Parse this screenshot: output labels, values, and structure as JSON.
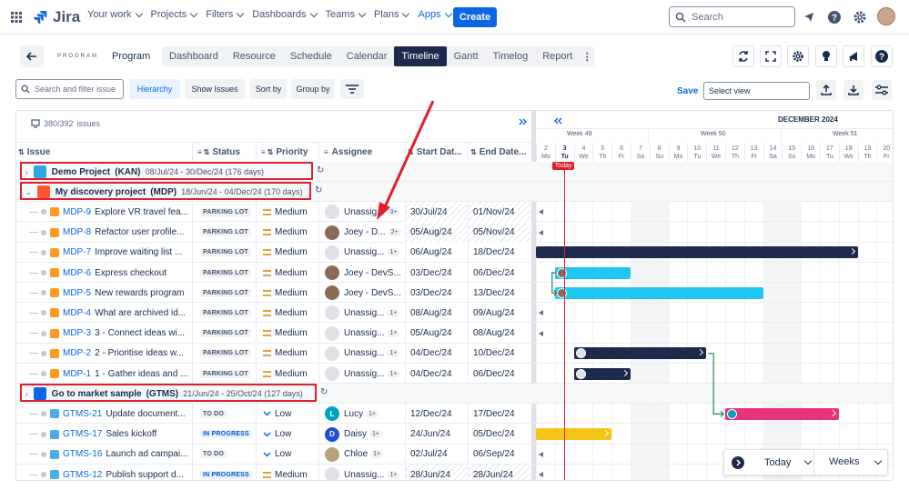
{
  "app": {
    "name": "Jira",
    "brand_color": "#0c66e4"
  },
  "topnav": {
    "items": [
      {
        "label": "Your work",
        "active": false
      },
      {
        "label": "Projects",
        "active": false
      },
      {
        "label": "Filters",
        "active": false
      },
      {
        "label": "Dashboards",
        "active": false
      },
      {
        "label": "Teams",
        "active": false
      },
      {
        "label": "Plans",
        "active": false
      },
      {
        "label": "Apps",
        "active": true
      }
    ],
    "create_label": "Create",
    "search_placeholder": "Search"
  },
  "program": {
    "badge": "PROGRAM",
    "name": "Program",
    "tabs": [
      "Dashboard",
      "Resource",
      "Schedule",
      "Calendar",
      "Timeline",
      "Gantt",
      "Timelog",
      "Report"
    ],
    "active_tab": "Timeline"
  },
  "filterbar": {
    "search_placeholder": "Search and filter issue",
    "hierarchy_label": "Hierarchy",
    "show_issues_label": "Show Issues",
    "sort_label": "Sort by",
    "group_label": "Group by",
    "save_label": "Save",
    "select_view_placeholder": "Select view"
  },
  "grid": {
    "issue_count": "380/392",
    "issue_count_suffix": "issues",
    "columns": {
      "issue": "Issue",
      "status": "Status",
      "priority": "Priority",
      "assignee": "Assignee",
      "start": "Start Dat...",
      "end": "End Date..."
    }
  },
  "timeline": {
    "month": "DECEMBER 2024",
    "weeks": [
      "Week 49",
      "Week 50",
      "Week 51"
    ],
    "days": [
      {
        "n": "2",
        "d": "Mo"
      },
      {
        "n": "3",
        "d": "Tu"
      },
      {
        "n": "4",
        "d": "We"
      },
      {
        "n": "5",
        "d": "Th"
      },
      {
        "n": "6",
        "d": "Fr"
      },
      {
        "n": "7",
        "d": "Sa"
      },
      {
        "n": "8",
        "d": "Su"
      },
      {
        "n": "9",
        "d": "Mo"
      },
      {
        "n": "10",
        "d": "Tu"
      },
      {
        "n": "11",
        "d": "We"
      },
      {
        "n": "12",
        "d": "Th"
      },
      {
        "n": "13",
        "d": "Fr"
      },
      {
        "n": "14",
        "d": "Sa"
      },
      {
        "n": "15",
        "d": "Su"
      },
      {
        "n": "16",
        "d": "Mo"
      },
      {
        "n": "17",
        "d": "Tu"
      },
      {
        "n": "18",
        "d": "We"
      },
      {
        "n": "19",
        "d": "Th"
      },
      {
        "n": "20",
        "d": "Fr"
      }
    ],
    "today_label": "Today",
    "zoom_today": "Today",
    "zoom_scale": "Weeks"
  },
  "groups": [
    {
      "name": "Demo Project",
      "key": "(KAN)",
      "dates": "08/Jul/24 - 30/Dec/24 (176 days)"
    },
    {
      "name": "My discovery project",
      "key": "(MDP)",
      "dates": "18/Jun/24 - 04/Dec/24 (170 days)"
    },
    {
      "name": "Go to market sample",
      "key": "(GTMS)",
      "dates": "21/Jun/24 - 25/Oct/24 (127 days)"
    }
  ],
  "rows": [
    {
      "key": "MDP-9",
      "summary": "Explore VR travel fea...",
      "status": "PARKING LOT",
      "priority": "Medium",
      "assignee": "Unassig...",
      "extra": "3+",
      "start": "30/Jul/24",
      "end": "01/Nov/24",
      "hatched": true
    },
    {
      "key": "MDP-8",
      "summary": "Refactor user profile...",
      "status": "PARKING LOT",
      "priority": "Medium",
      "assignee": "Joey - D...",
      "extra": "2+",
      "start": "05/Aug/24",
      "end": "05/Nov/24",
      "hatched": true
    },
    {
      "key": "MDP-7",
      "summary": "Improve waiting list ...",
      "status": "PARKING LOT",
      "priority": "Medium",
      "assignee": "Unassig...",
      "extra": "1+",
      "start": "06/Aug/24",
      "end": "18/Dec/24",
      "hatched": false
    },
    {
      "key": "MDP-6",
      "summary": "Express checkout",
      "status": "PARKING LOT",
      "priority": "Medium",
      "assignee": "Joey - DevS...",
      "extra": "",
      "start": "03/Dec/24",
      "end": "06/Dec/24",
      "hatched": false
    },
    {
      "key": "MDP-5",
      "summary": "New rewards program",
      "status": "PARKING LOT",
      "priority": "Medium",
      "assignee": "Joey - DevS...",
      "extra": "",
      "start": "03/Dec/24",
      "end": "13/Dec/24",
      "hatched": false
    },
    {
      "key": "MDP-4",
      "summary": "What are archived id...",
      "status": "PARKING LOT",
      "priority": "Medium",
      "assignee": "Unassig...",
      "extra": "1+",
      "start": "08/Aug/24",
      "end": "09/Aug/24",
      "hatched": false
    },
    {
      "key": "MDP-3",
      "summary": "3 - Connect ideas wi...",
      "status": "PARKING LOT",
      "priority": "Medium",
      "assignee": "Unassig...",
      "extra": "1+",
      "start": "05/Aug/24",
      "end": "08/Aug/24",
      "hatched": false
    },
    {
      "key": "MDP-2",
      "summary": "2 - Prioritise ideas w...",
      "status": "PARKING LOT",
      "priority": "Medium",
      "assignee": "Unassig...",
      "extra": "1+",
      "start": "04/Dec/24",
      "end": "10/Dec/24",
      "hatched": false
    },
    {
      "key": "MDP-1",
      "summary": "1 - Gather ideas and ...",
      "status": "PARKING LOT",
      "priority": "Medium",
      "assignee": "Unassig...",
      "extra": "1+",
      "start": "04/Dec/24",
      "end": "06/Dec/24",
      "hatched": false
    },
    {
      "key": "GTMS-21",
      "summary": "Update document...",
      "status": "TO DO",
      "priority": "Low",
      "assignee": "Lucy",
      "extra": "1+",
      "start": "12/Dec/24",
      "end": "17/Dec/24",
      "hatched": false
    },
    {
      "key": "GTMS-17",
      "summary": "Sales kickoff",
      "status": "IN PROGRESS",
      "priority": "Low",
      "assignee": "Daisy",
      "extra": "1+",
      "start": "24/Jun/24",
      "end": "05/Dec/24",
      "hatched": false
    },
    {
      "key": "GTMS-16",
      "summary": "Launch ad campai...",
      "status": "TO DO",
      "priority": "Low",
      "assignee": "Chloe",
      "extra": "1+",
      "start": "02/Jul/24",
      "end": "06/Sep/24",
      "hatched": false
    },
    {
      "key": "GTMS-12",
      "summary": "Publish support d...",
      "status": "IN PROGRESS",
      "priority": "Medium",
      "assignee": "Unassig...",
      "extra": "1+",
      "start": "28/Jun/24",
      "end": "28/Jun/24",
      "hatched": true
    }
  ]
}
